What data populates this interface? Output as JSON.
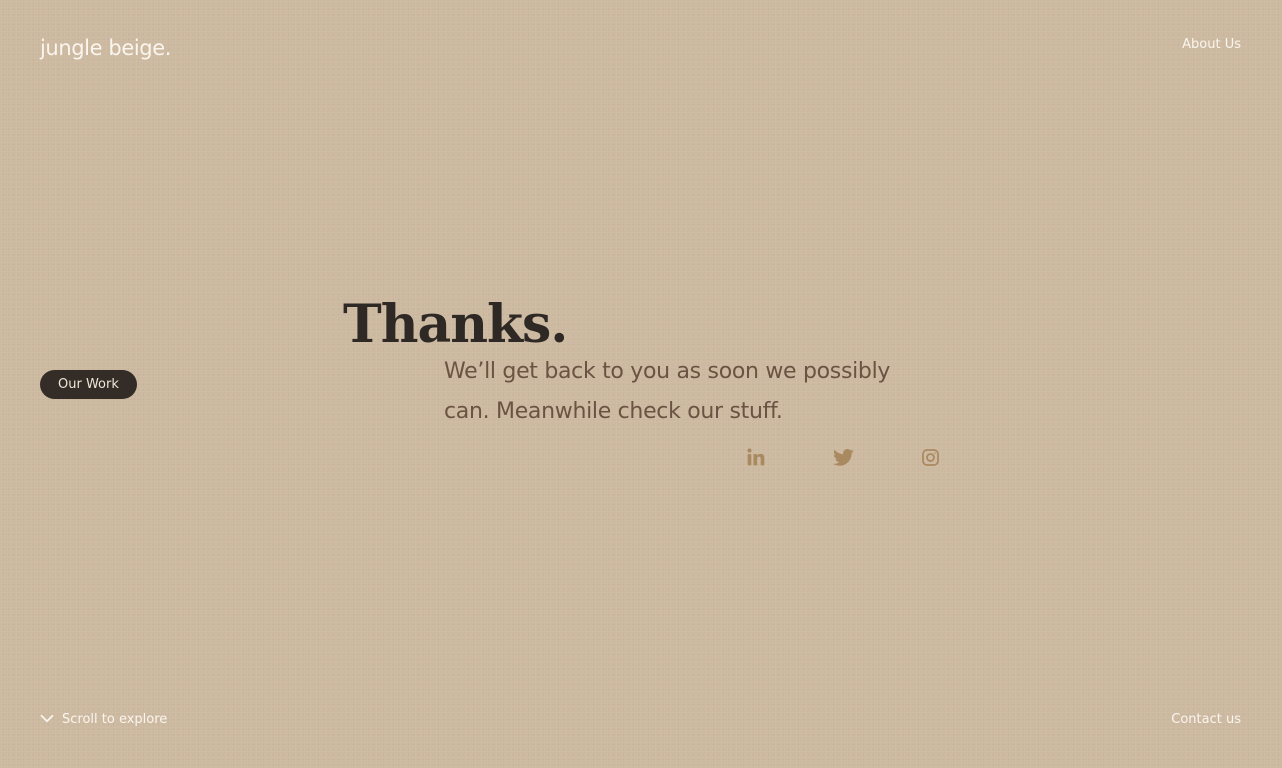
{
  "header": {
    "logo_text": "jungle beige.",
    "about_label": "About Us"
  },
  "side": {
    "our_work_label": "Our Work"
  },
  "main": {
    "headline": "Thanks.",
    "message": "We’ll get back to you as soon we possibly can. Meanwhile check our stuff.",
    "social": [
      {
        "name": "linkedin",
        "icon": "linkedin-icon"
      },
      {
        "name": "twitter",
        "icon": "twitter-icon"
      },
      {
        "name": "instagram",
        "icon": "instagram-icon"
      }
    ]
  },
  "footer": {
    "scroll_label": "Scroll to explore",
    "contact_label": "Contact us"
  },
  "colors": {
    "background": "#cdb9a0",
    "headline": "#2e2925",
    "message": "#6a5342",
    "icon": "#a9895f",
    "light_text": "#faf5ee",
    "button_bg": "#332c27"
  }
}
